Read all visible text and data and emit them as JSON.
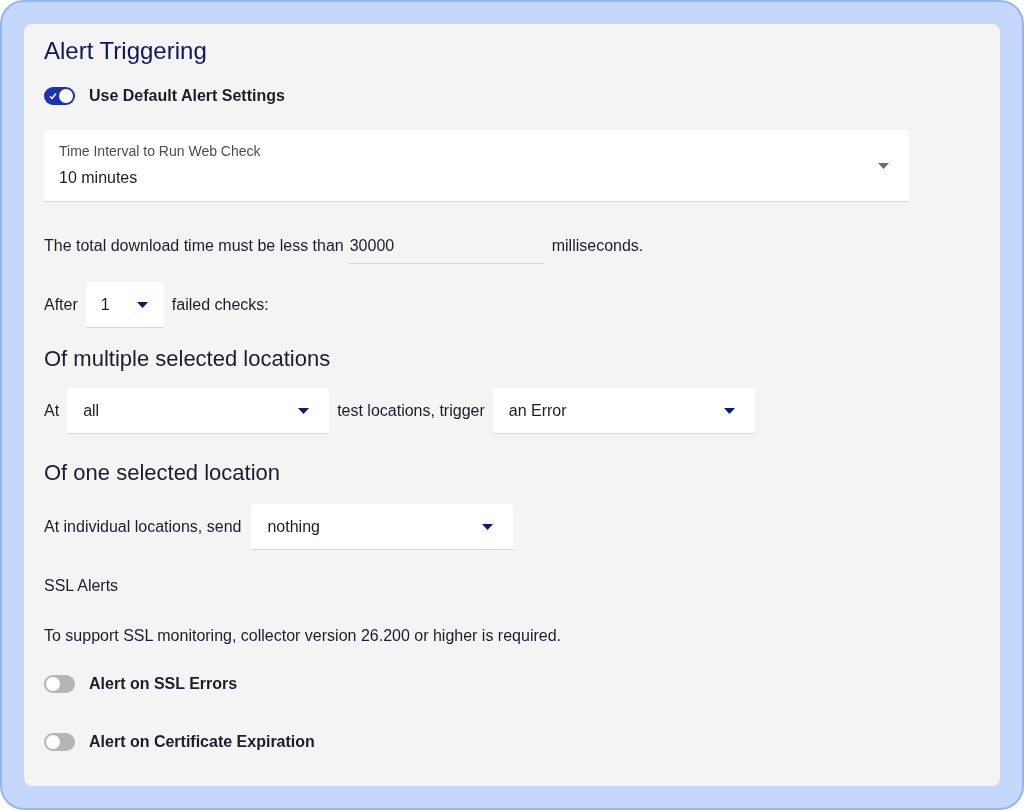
{
  "title": "Alert Triggering",
  "default_toggle": {
    "label": "Use Default Alert Settings",
    "on": true
  },
  "interval_select": {
    "label": "Time Interval to Run Web Check",
    "value": "10 minutes"
  },
  "download_row": {
    "before": "The total download time must be less than",
    "value": "30000",
    "after": "milliseconds."
  },
  "failed_row": {
    "before": "After",
    "value": "1",
    "after": "failed checks:"
  },
  "multiple_heading": "Of multiple selected locations",
  "multiple_row": {
    "before": "At",
    "select_1": "all",
    "middle": "test locations, trigger",
    "select_2": "an Error"
  },
  "single_heading": "Of one selected location",
  "single_row": {
    "before": "At individual locations, send",
    "select": "nothing"
  },
  "ssl_heading": "SSL Alerts",
  "ssl_note": "To support SSL monitoring, collector version 26.200 or higher is required.",
  "ssl_toggles": [
    {
      "label": "Alert on SSL Errors",
      "on": false
    },
    {
      "label": "Alert on Certificate Expiration",
      "on": false
    }
  ]
}
